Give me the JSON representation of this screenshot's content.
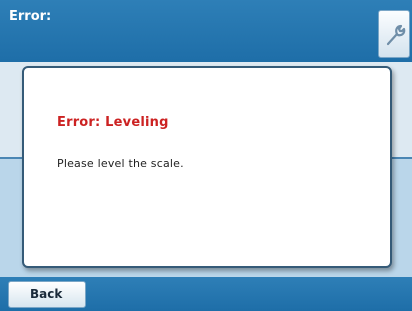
{
  "header": {
    "title": "Error:",
    "settings_icon": "wrench-icon"
  },
  "dialog": {
    "title": "Error: Leveling",
    "message": "Please level the scale."
  },
  "footer": {
    "back_label": "Back"
  },
  "colors": {
    "header_blue": "#1e6ea8",
    "error_red": "#cc2222",
    "background_light": "#dde9f2",
    "background_mid": "#bad6ea"
  }
}
